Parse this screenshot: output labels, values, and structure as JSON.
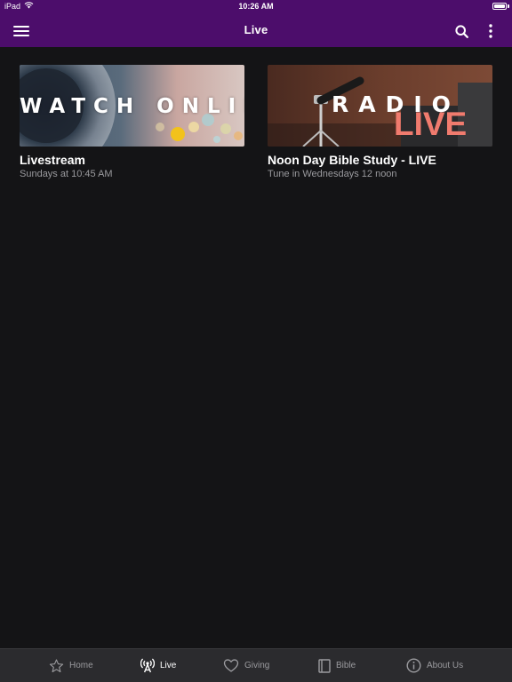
{
  "status_bar": {
    "device": "iPad",
    "time": "10:26 AM",
    "wifi_icon": "wifi-icon",
    "battery_icon": "battery-icon"
  },
  "nav": {
    "title": "Live",
    "menu_icon": "hamburger-menu-icon",
    "search_icon": "search-icon",
    "more_icon": "more-vertical-icon",
    "background_color": "#4c0d6b"
  },
  "cards": [
    {
      "image_text": "WATCH ONLINE",
      "title": "Livestream",
      "subtitle": "Sundays at 10:45 AM"
    },
    {
      "image_text_top": "RADIO",
      "image_text_bottom": "LIVE",
      "title": "Noon Day Bible Study - LIVE",
      "subtitle": "Tune in Wednesdays 12 noon"
    }
  ],
  "tabs": [
    {
      "label": "Home",
      "icon": "star-icon",
      "active": false
    },
    {
      "label": "Live",
      "icon": "broadcast-icon",
      "active": true
    },
    {
      "label": "Giving",
      "icon": "heart-icon",
      "active": false
    },
    {
      "label": "Bible",
      "icon": "book-icon",
      "active": false
    },
    {
      "label": "About Us",
      "icon": "info-icon",
      "active": false
    }
  ],
  "colors": {
    "accent": "#4c0d6b",
    "background": "#141416",
    "tab_bar": "#2b2b2e",
    "live_text": "#f07b6e"
  }
}
